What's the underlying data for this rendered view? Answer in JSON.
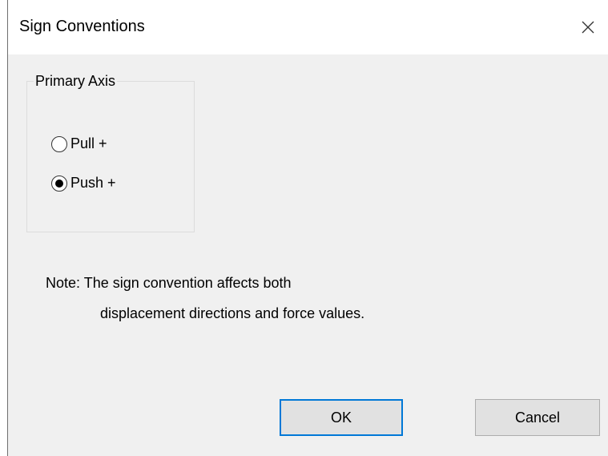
{
  "dialog": {
    "title": "Sign Conventions",
    "close_icon": "close-icon"
  },
  "primary_axis": {
    "legend": "Primary Axis",
    "options": [
      {
        "label": "Pull +",
        "checked": false
      },
      {
        "label": "Push +",
        "checked": true
      }
    ]
  },
  "note": {
    "line1": "Note:  The sign convention affects both",
    "line2": "displacement directions and force values."
  },
  "buttons": {
    "ok_label": "OK",
    "cancel_label": "Cancel"
  },
  "colors": {
    "dialog_bg": "#f0f0f0",
    "title_bg": "#ffffff",
    "focus_border": "#0078d7",
    "button_bg": "#e1e1e1"
  }
}
